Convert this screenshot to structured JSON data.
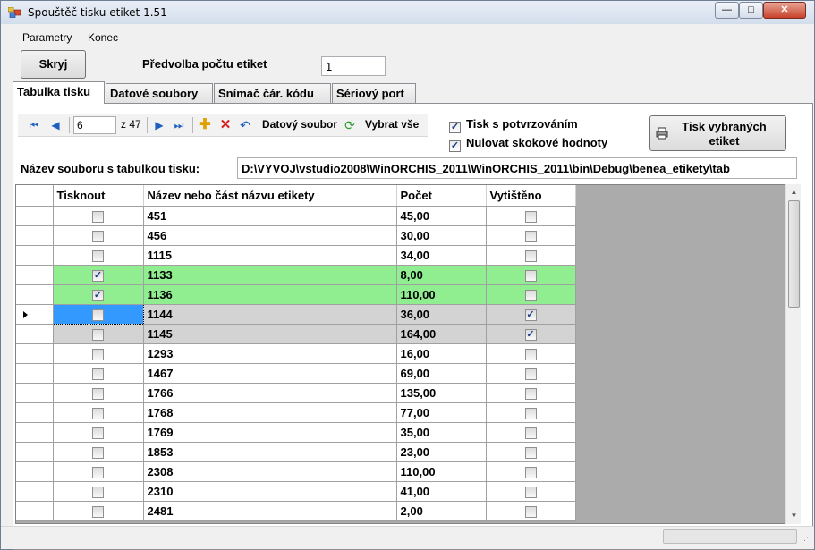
{
  "window": {
    "title": "Spouštěč tisku etiket 1.51",
    "minimize": "—",
    "maximize": "□",
    "close": "✕"
  },
  "menu": {
    "items": [
      "Parametry",
      "Konec"
    ]
  },
  "header": {
    "hide_button": "Skryj",
    "preset_label": "Předvolba počtu etiket",
    "preset_value": "1"
  },
  "tabs": [
    "Tabulka tisku",
    "Datové soubory",
    "Snímač čár. kódu",
    "Sériový port"
  ],
  "navigator": {
    "position": "6",
    "of_total": "z 47",
    "data_file_label": "Datový soubor",
    "select_all_label": "Vybrat vše"
  },
  "options": {
    "confirm_print": {
      "label": "Tisk s potvrzováním",
      "checked": true
    },
    "reset_values": {
      "label": "Nulovat skokové hodnoty",
      "checked": true
    }
  },
  "print_button": {
    "line1": "Tisk vybraných",
    "line2": "etiket"
  },
  "file": {
    "label": "Název souboru s tabulkou tisku:",
    "path": "D:\\VYVOJ\\vstudio2008\\WinORCHIS_2011\\WinORCHIS_2011\\bin\\Debug\\benea_etikety\\tab"
  },
  "grid": {
    "columns": [
      "Tisknout",
      "Název nebo část názvu etikety",
      "Počet",
      "Vytištěno"
    ],
    "rows": [
      {
        "print": false,
        "name": "451",
        "count": "45,00",
        "printed": false,
        "style": ""
      },
      {
        "print": false,
        "name": "456",
        "count": "30,00",
        "printed": false,
        "style": ""
      },
      {
        "print": false,
        "name": "1115",
        "count": "34,00",
        "printed": false,
        "style": ""
      },
      {
        "print": true,
        "name": "1133",
        "count": "8,00",
        "printed": false,
        "style": "green"
      },
      {
        "print": true,
        "name": "1136",
        "count": "110,00",
        "printed": false,
        "style": "green"
      },
      {
        "print": false,
        "name": "1144",
        "count": "36,00",
        "printed": true,
        "style": "gray",
        "current": true
      },
      {
        "print": false,
        "name": "1145",
        "count": "164,00",
        "printed": true,
        "style": "gray"
      },
      {
        "print": false,
        "name": "1293",
        "count": "16,00",
        "printed": false,
        "style": ""
      },
      {
        "print": false,
        "name": "1467",
        "count": "69,00",
        "printed": false,
        "style": ""
      },
      {
        "print": false,
        "name": "1766",
        "count": "135,00",
        "printed": false,
        "style": ""
      },
      {
        "print": false,
        "name": "1768",
        "count": "77,00",
        "printed": false,
        "style": ""
      },
      {
        "print": false,
        "name": "1769",
        "count": "35,00",
        "printed": false,
        "style": ""
      },
      {
        "print": false,
        "name": "1853",
        "count": "23,00",
        "printed": false,
        "style": ""
      },
      {
        "print": false,
        "name": "2308",
        "count": "110,00",
        "printed": false,
        "style": ""
      },
      {
        "print": false,
        "name": "2310",
        "count": "41,00",
        "printed": false,
        "style": ""
      },
      {
        "print": false,
        "name": "2481",
        "count": "2,00",
        "printed": false,
        "style": ""
      }
    ]
  },
  "colors": {
    "printed_row": "#d3d3d3",
    "selected_row": "#90ee90",
    "current_cell": "#3399ff"
  }
}
